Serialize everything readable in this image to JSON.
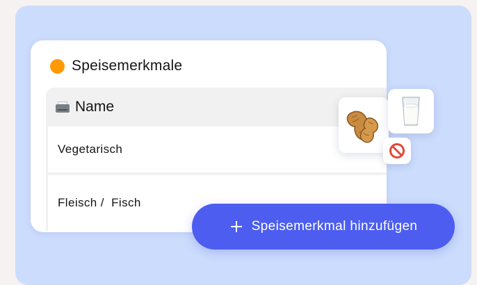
{
  "panel": {
    "title": "Speisemerkmale",
    "accent_dot_color": "#ff9a06",
    "background_color": "#ccdcfd"
  },
  "table": {
    "header": {
      "icon": "name-badge-icon",
      "label": "Name"
    },
    "rows": [
      {
        "label": "Vegetarisch"
      },
      {
        "label": "Fleisch /  Fisch"
      }
    ]
  },
  "allergen_badges": [
    {
      "icon": "peanut-icon"
    },
    {
      "icon": "milk-glass-icon"
    },
    {
      "icon": "prohibited-icon"
    }
  ],
  "add_button": {
    "icon": "plus-icon",
    "label": "Speisemerkmal hinzufügen",
    "color": "#4c5df0"
  }
}
